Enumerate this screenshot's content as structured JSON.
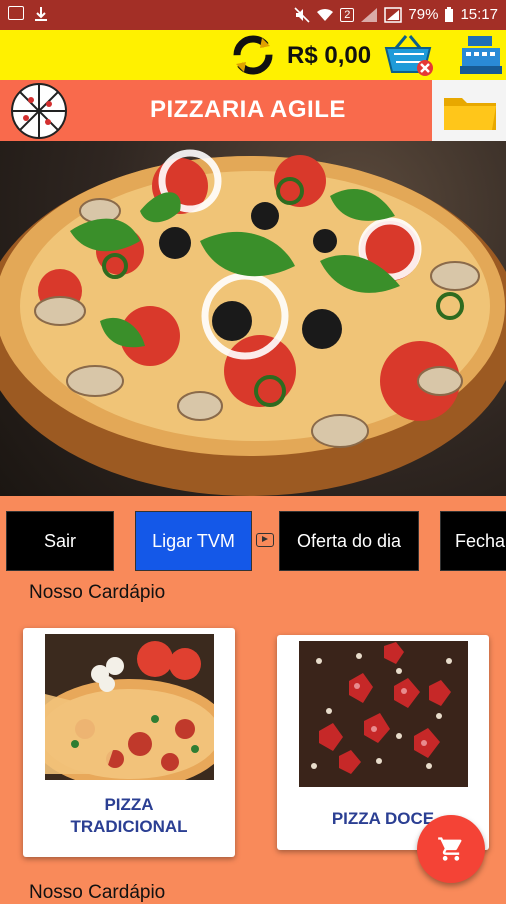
{
  "status_bar": {
    "battery": "79%",
    "time": "15:17",
    "sim_badge": "2"
  },
  "top_bar": {
    "balance": "R$ 0,00"
  },
  "header": {
    "title": "PIZZARIA AGILE"
  },
  "actions": [
    {
      "label": "Sair"
    },
    {
      "label": "Ligar TVM"
    },
    {
      "label": "Oferta do dia"
    },
    {
      "label": "Fecha"
    }
  ],
  "menu_sections": [
    {
      "title": "Nosso Cardápio",
      "items": [
        {
          "line1": "PIZZA",
          "line2": "TRADICIONAL"
        },
        {
          "line1": "PIZZA DOCE",
          "line2": ""
        }
      ]
    },
    {
      "title": "Nosso Cardápio"
    }
  ],
  "colors": {
    "status_bar": "#a32f26",
    "top_bar": "#fff100",
    "header": "#f96a4c",
    "background": "#f98a5a",
    "accent_blue": "#1458e8",
    "fab": "#f44336",
    "label_blue": "#2b3f93"
  },
  "icons": [
    "image-icon",
    "download-icon",
    "mute-icon",
    "wifi-icon",
    "signal-icon",
    "battery-icon",
    "refresh-icon",
    "basket-icon",
    "cash-register-icon",
    "pizza-logo-icon",
    "folder-icon",
    "youtube-icon",
    "cart-icon"
  ]
}
